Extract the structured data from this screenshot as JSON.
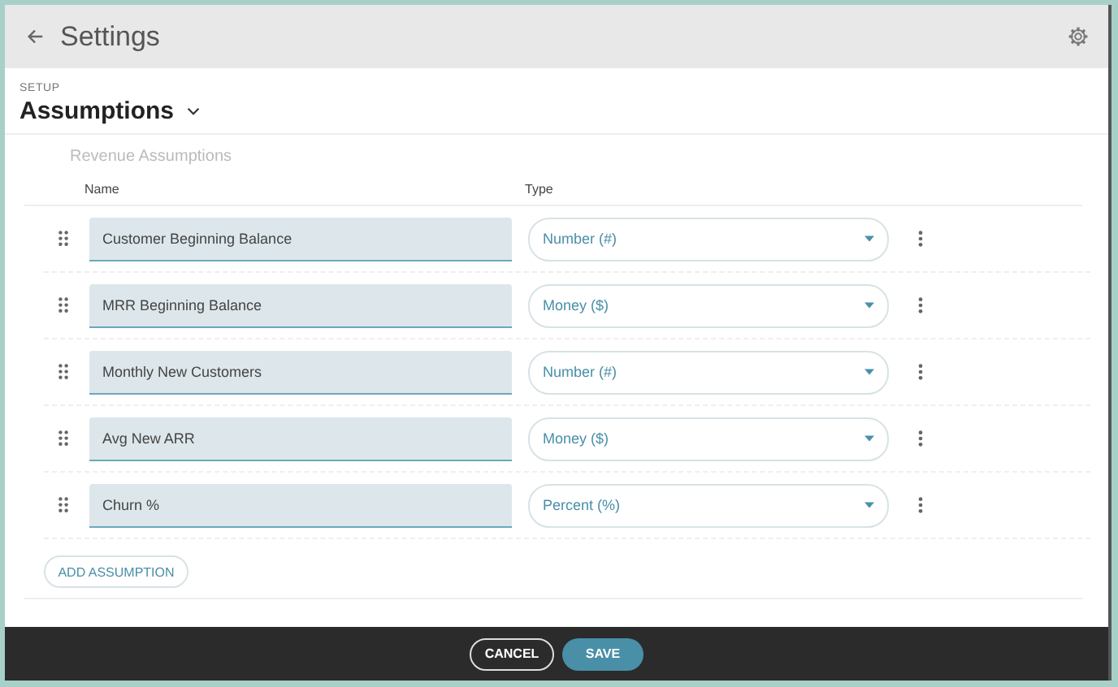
{
  "header": {
    "title": "Settings"
  },
  "page": {
    "section": "SETUP",
    "title": "Assumptions"
  },
  "card": {
    "title": "Revenue Assumptions",
    "columns": [
      "Name",
      "Type"
    ],
    "rows": [
      {
        "name": "Customer Beginning Balance",
        "type": "Number (#)"
      },
      {
        "name": "MRR Beginning Balance",
        "type": "Money ($)"
      },
      {
        "name": "Monthly New Customers",
        "type": "Number (#)"
      },
      {
        "name": "Avg New ARR",
        "type": "Money ($)"
      },
      {
        "name": "Churn %",
        "type": "Percent (%)"
      }
    ],
    "add_button": "ADD ASSUMPTION"
  },
  "footer": {
    "buttons": [
      {
        "label": "CANCEL",
        "kind": "secondary"
      },
      {
        "label": "SAVE",
        "kind": "primary"
      }
    ]
  }
}
